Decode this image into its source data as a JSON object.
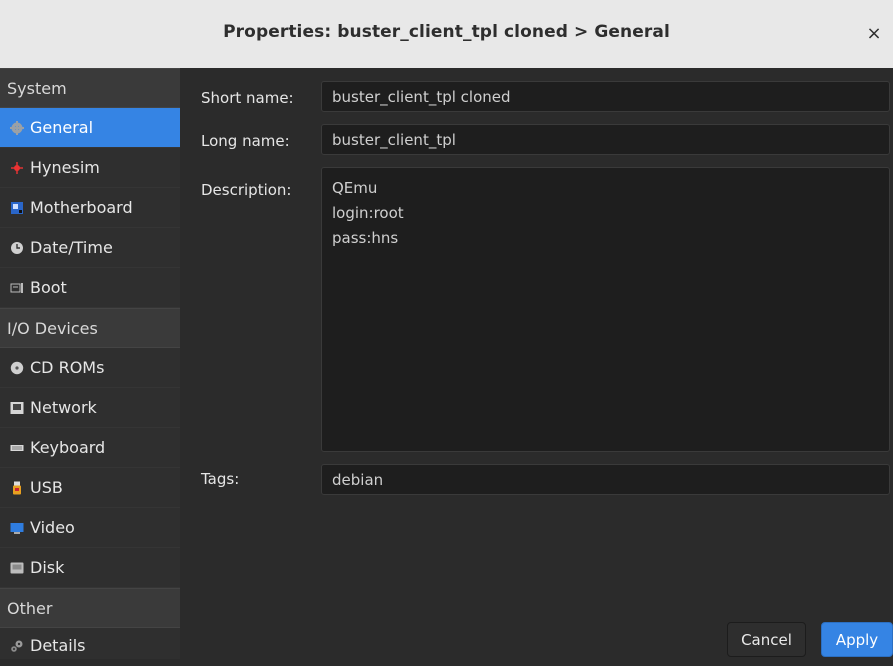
{
  "window": {
    "title": "Properties: buster_client_tpl cloned > General",
    "close_label": "×"
  },
  "sidebar": {
    "sections": [
      {
        "header": "System",
        "items": [
          {
            "label": "General",
            "icon": "gear-icon",
            "active": true
          },
          {
            "label": "Hynesim",
            "icon": "hynesim-icon"
          },
          {
            "label": "Motherboard",
            "icon": "motherboard-icon"
          },
          {
            "label": "Date/Time",
            "icon": "clock-icon"
          },
          {
            "label": "Boot",
            "icon": "boot-icon"
          }
        ]
      },
      {
        "header": "I/O Devices",
        "items": [
          {
            "label": "CD ROMs",
            "icon": "cdrom-icon"
          },
          {
            "label": "Network",
            "icon": "network-icon"
          },
          {
            "label": "Keyboard",
            "icon": "keyboard-icon"
          },
          {
            "label": "USB",
            "icon": "usb-icon"
          },
          {
            "label": "Video",
            "icon": "video-icon"
          },
          {
            "label": "Disk",
            "icon": "disk-icon"
          }
        ]
      },
      {
        "header": "Other",
        "items": [
          {
            "label": "Details",
            "icon": "details-icon"
          }
        ]
      }
    ]
  },
  "form": {
    "short_name": {
      "label": "Short name:",
      "value": "buster_client_tpl cloned"
    },
    "long_name": {
      "label": "Long name:",
      "value": "buster_client_tpl"
    },
    "description": {
      "label": "Description:",
      "value": "QEmu\nlogin:root\npass:hns"
    },
    "tags": {
      "label": "Tags:",
      "value": "debian"
    }
  },
  "buttons": {
    "cancel": "Cancel",
    "apply": "Apply"
  },
  "colors": {
    "accent": "#3584e4",
    "background": "#2b2b2b",
    "titlebar": "#e8e8e8"
  }
}
